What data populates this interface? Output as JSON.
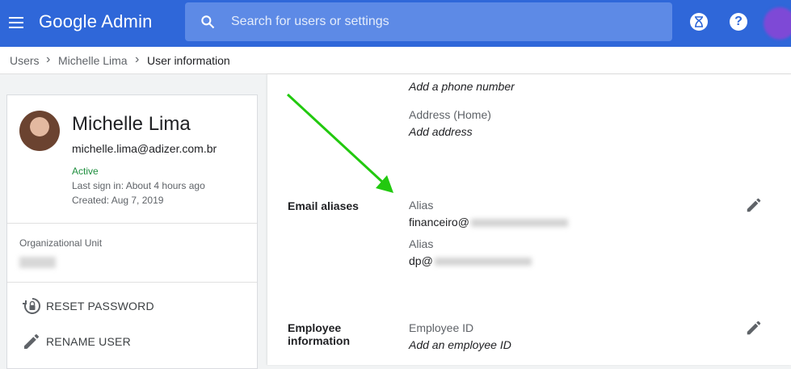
{
  "app": {
    "title": "Google Admin"
  },
  "search": {
    "placeholder": "Search for users or settings"
  },
  "breadcrumb": {
    "items": [
      "Users",
      "Michelle Lima",
      "User information"
    ]
  },
  "user": {
    "name": "Michelle Lima",
    "email": "michelle.lima@adizer.com.br",
    "status": "Active",
    "last_sign_in": "Last sign in: About 4 hours ago",
    "created": "Created: Aug 7, 2019"
  },
  "org_unit": {
    "label": "Organizational Unit"
  },
  "actions": {
    "reset_password": "RESET PASSWORD",
    "rename_user": "RENAME USER"
  },
  "contact": {
    "phone_hint": "Add a phone number",
    "address_label": "Address (Home)",
    "address_hint": "Add address"
  },
  "email_aliases": {
    "title": "Email aliases",
    "aliases": [
      {
        "label": "Alias",
        "value": "financeiro@"
      },
      {
        "label": "Alias",
        "value": "dp@"
      }
    ]
  },
  "employee": {
    "title_line1": "Employee",
    "title_line2": "information",
    "id_label": "Employee ID",
    "id_hint": "Add an employee ID"
  },
  "colors": {
    "header": "#2f67d9",
    "active": "#1e8e3e",
    "arrow": "#22c90f"
  }
}
